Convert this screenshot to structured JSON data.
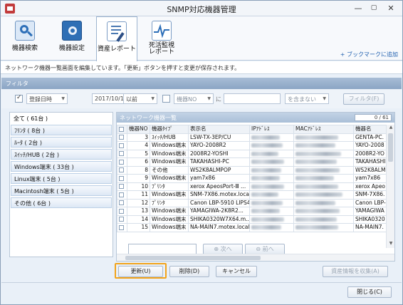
{
  "window": {
    "title": "SNMP対応機器管理",
    "min": "—",
    "max": "▢",
    "close": "✕"
  },
  "ribbon": {
    "tabs": [
      {
        "label": "機器検索"
      },
      {
        "label": "機器設定"
      },
      {
        "label": "資産レポート"
      },
      {
        "label": "死活監視\nレポート"
      }
    ],
    "bookmark_link": "+ ブックマークに追加"
  },
  "info": {
    "text": "ネットワーク機器一覧画面を編集しています。「更新」ボタンを押すと変更が保存されます。"
  },
  "filter": {
    "title": "フィルタ",
    "date_field": "登録日時",
    "date_value": "2017/10/17",
    "date_cond": "以前",
    "field2": "機器NO",
    "ni": "に",
    "match": "を含まない",
    "button": "フィルタ(F)"
  },
  "groups": [
    {
      "label": "全て ( 61台 )"
    },
    {
      "label": "ﾌﾘﾝﾀ ( 8台 )"
    },
    {
      "label": "ﾙｰﾀ ( 2台 )"
    },
    {
      "label": "ｽｲｯﾁ/HUB ( 2台 )"
    },
    {
      "label": "Windows端末 ( 33台 )"
    },
    {
      "label": "Linux端末 ( 5台 )"
    },
    {
      "label": "Macintosh端末 ( 5台 )"
    },
    {
      "label": "その他 ( 6台 )"
    }
  ],
  "list": {
    "title": "ネットワーク機器一覧",
    "count": "0 / 61",
    "columns": [
      "",
      "機器NO",
      "機器ﾀｲﾌﾟ",
      "表示名",
      "IPｱﾄﾞﾚｽ",
      "MACｱﾄﾞﾚｽ",
      "機器名"
    ],
    "rows": [
      {
        "no": "3",
        "type": "ｽｲｯﾁ/HUB",
        "disp": "LSW-TX-3EP/CU",
        "name": "GENTA-PC."
      },
      {
        "no": "4",
        "type": "Windows端末",
        "disp": "YAYO-2008R2",
        "name": "YAYO-2008"
      },
      {
        "no": "5",
        "type": "Windows端末",
        "disp": "2008R2-YOSHI",
        "name": "2008R2-YO"
      },
      {
        "no": "6",
        "type": "Windows端末",
        "disp": "TAKAHASHI-PC",
        "name": "TAKAHASHI"
      },
      {
        "no": "8",
        "type": "その他",
        "disp": "WS2K8ALMPOP",
        "name": "WS2K8ALMP"
      },
      {
        "no": "9",
        "type": "Windows端末",
        "disp": "yam7x86",
        "name": "yam7x86"
      },
      {
        "no": "10",
        "type": "ﾌﾟﾘﾝﾀ",
        "disp": "xerox ApeosPort-Ⅲ ...",
        "name": "xerox Apeo"
      },
      {
        "no": "11",
        "type": "Windows端末",
        "disp": "SNM-7X86.motex.local",
        "name": "SNM-7X86."
      },
      {
        "no": "12",
        "type": "ﾌﾟﾘﾝﾀ",
        "disp": "Canon LBP-5910 LIPS4",
        "name": "Canon LBP-"
      },
      {
        "no": "13",
        "type": "Windows端末",
        "disp": "YAMAGIWA-2K8R2...",
        "name": "YAMAGIWA"
      },
      {
        "no": "14",
        "type": "Windows端末",
        "disp": "SHIKA0320W7X64.m...",
        "name": "SHIKA0320"
      },
      {
        "no": "15",
        "type": "Windows端末",
        "disp": "NA-MAIN7.motex.local",
        "name": "NA-MAIN7."
      }
    ],
    "next": "次へ",
    "prev": "前へ"
  },
  "buttons": {
    "update": "更新(U)",
    "delete": "削除(D)",
    "cancel": "キャンセル",
    "collect": "資産情報を収集(A)",
    "close": "閉じる(C)"
  }
}
